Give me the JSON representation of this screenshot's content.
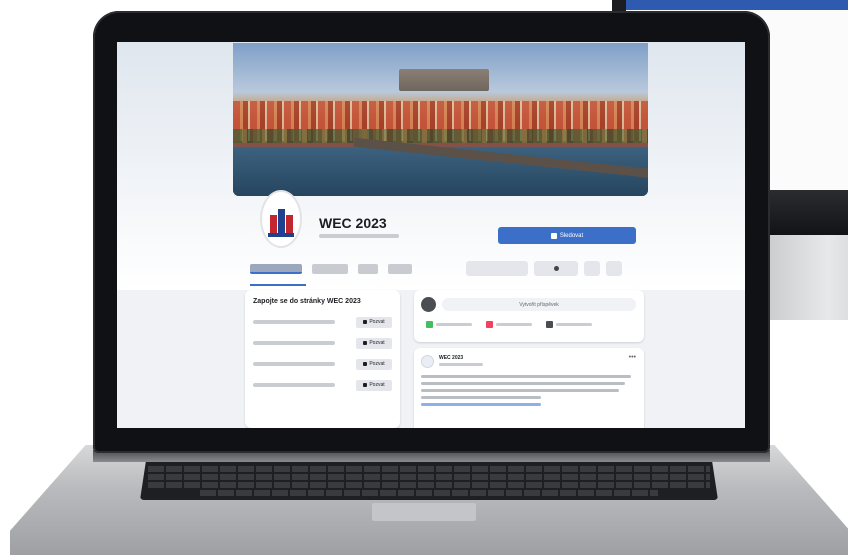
{
  "page": {
    "name": "WEC 2023",
    "follow_label": "Sledovat"
  },
  "invite_card": {
    "title": "Zapojte se do stránky WEC 2023",
    "rows": [
      {
        "button": "Pozvat"
      },
      {
        "button": "Pozvat"
      },
      {
        "button": "Pozvat"
      },
      {
        "button": "Pozvat"
      }
    ]
  },
  "composer": {
    "placeholder": "Vytvořit příspěvek"
  },
  "post": {
    "author": "WEC 2023",
    "menu_icon": "more-horizontal-icon"
  },
  "colors": {
    "brand_blue": "#3b6fc8",
    "monitor_accent": "#2e5bb0"
  }
}
